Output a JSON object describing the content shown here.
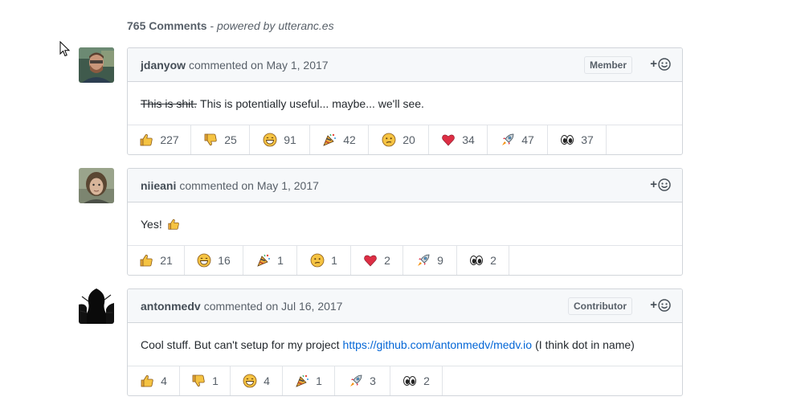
{
  "header": {
    "count_label": "765 Comments",
    "separator": " - ",
    "powered_by": "powered by utteranc.es"
  },
  "comments": [
    {
      "author": "jdanyow",
      "meta": "commented on May 1, 2017",
      "badge": "Member",
      "body_struck": "This is shit.",
      "body_text": "This is potentially useful... maybe... we'll see.",
      "reactions": [
        {
          "icon": "thumbs-up-icon",
          "count": "227"
        },
        {
          "icon": "thumbs-down-icon",
          "count": "25"
        },
        {
          "icon": "laugh-icon",
          "count": "91"
        },
        {
          "icon": "party-icon",
          "count": "42"
        },
        {
          "icon": "confused-icon",
          "count": "20"
        },
        {
          "icon": "heart-icon",
          "count": "34"
        },
        {
          "icon": "rocket-icon",
          "count": "47"
        },
        {
          "icon": "eyes-icon",
          "count": "37"
        }
      ]
    },
    {
      "author": "niieani",
      "meta": "commented on May 1, 2017",
      "body_text": "Yes!",
      "reactions": [
        {
          "icon": "thumbs-up-icon",
          "count": "21"
        },
        {
          "icon": "laugh-icon",
          "count": "16"
        },
        {
          "icon": "party-icon",
          "count": "1"
        },
        {
          "icon": "confused-icon",
          "count": "1"
        },
        {
          "icon": "heart-icon",
          "count": "2"
        },
        {
          "icon": "rocket-icon",
          "count": "9"
        },
        {
          "icon": "eyes-icon",
          "count": "2"
        }
      ]
    },
    {
      "author": "antonmedv",
      "meta": "commented on Jul 16, 2017",
      "badge": "Contributor",
      "body_text": "Cool stuff. But can't setup for my project",
      "body_link": "https://github.com/antonmedv/medv.io",
      "body_after": "(I think dot in name)",
      "reactions": [
        {
          "icon": "thumbs-up-icon",
          "count": "4"
        },
        {
          "icon": "thumbs-down-icon",
          "count": "1"
        },
        {
          "icon": "laugh-icon",
          "count": "4"
        },
        {
          "icon": "party-icon",
          "count": "1"
        },
        {
          "icon": "rocket-icon",
          "count": "3"
        },
        {
          "icon": "eyes-icon",
          "count": "2"
        }
      ]
    }
  ],
  "colors": {
    "border": "#d1d5da",
    "header_bg": "#f6f8fa",
    "link": "#0366d6",
    "muted": "#586069"
  }
}
